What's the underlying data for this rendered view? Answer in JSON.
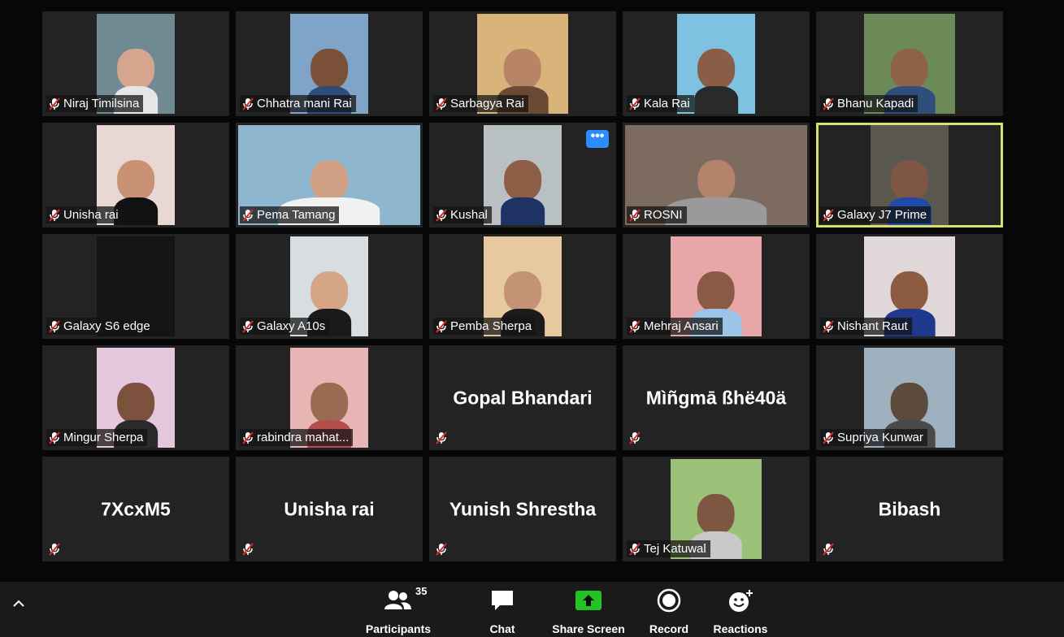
{
  "tiles": [
    {
      "label": "Niraj Timilsina",
      "video": true,
      "bg": "#6f8a93",
      "skin": "#d5a58e",
      "shirt": "#e6e6e6"
    },
    {
      "label": "Chhatra mani Rai",
      "video": true,
      "bg": "#7fa4c8",
      "skin": "#7a5138",
      "shirt": "#2e4b7a"
    },
    {
      "label": "Sarbagya Rai",
      "video": true,
      "bg": "#d8b47a",
      "skin": "#b78566",
      "shirt": "#6a4a35"
    },
    {
      "label": "Kala Rai",
      "video": true,
      "bg": "#7ec1e0",
      "skin": "#8a5d46",
      "shirt": "#2a2a2a"
    },
    {
      "label": "Bhanu Kapadi",
      "video": true,
      "bg": "#6b8a58",
      "skin": "#8e6248",
      "shirt": "#2f4f7a"
    },
    {
      "label": "Unisha rai",
      "video": true,
      "bg": "#e8d7d2",
      "skin": "#c99275",
      "shirt": "#111111"
    },
    {
      "label": "Pema Tamang",
      "video": true,
      "bg": "#8fb6cf",
      "skin": "#d1a084",
      "shirt": "#f1f1f1"
    },
    {
      "label": "Kushal",
      "video": true,
      "bg": "#b8c0c4",
      "skin": "#8d5d45",
      "shirt": "#1f3265",
      "more": "•••"
    },
    {
      "label": "ROSNI",
      "video": true,
      "bg": "#7c6b5e",
      "skin": "#b5826b",
      "shirt": "#9a9a9a"
    },
    {
      "label": "Galaxy J7 Prime",
      "video": true,
      "bg": "#5b5850",
      "skin": "#7f5643",
      "shirt": "#1e4aa8",
      "active": true
    },
    {
      "label": "Galaxy S6 edge",
      "video": true,
      "bg": "#141414",
      "skin": "#141414",
      "shirt": "#141414"
    },
    {
      "label": "Galaxy A10s",
      "video": true,
      "bg": "#d8dde2",
      "skin": "#d6a486",
      "shirt": "#1a1a1a"
    },
    {
      "label": "Pemba Sherpa",
      "video": true,
      "bg": "#e7c9a0",
      "skin": "#c49274",
      "shirt": "#1b1b1b"
    },
    {
      "label": "Mehraj Ansari",
      "video": true,
      "bg": "#e7a6a8",
      "skin": "#8a5a45",
      "shirt": "#9bc4e8"
    },
    {
      "label": "Nishant Raut",
      "video": true,
      "bg": "#dfd7d8",
      "skin": "#8d5b42",
      "shirt": "#1f3a8c"
    },
    {
      "label": "Mingur Sherpa",
      "video": true,
      "bg": "#e5c8de",
      "skin": "#7c523f",
      "shirt": "#2a2a2a"
    },
    {
      "label": "rabindra mahat...",
      "video": true,
      "bg": "#e7b5b3",
      "skin": "#9a6a52",
      "shirt": "#b44e4b"
    },
    {
      "label": "",
      "name_text": "Gopal Bhandari",
      "video": false
    },
    {
      "label": "",
      "name_text": "Mìñgmā ßhë40ä",
      "video": false
    },
    {
      "label": "Supriya Kunwar",
      "video": true,
      "bg": "#9fb0bf",
      "skin": "#5c4a3b",
      "shirt": "#4a4a4a"
    },
    {
      "label": "",
      "name_text": "7XcxM5",
      "video": false
    },
    {
      "label": "",
      "name_text": "Unisha rai",
      "video": false
    },
    {
      "label": "",
      "name_text": "Yunish Shrestha",
      "video": false
    },
    {
      "label": "Tej Katuwal",
      "video": true,
      "bg": "#9cc27a",
      "skin": "#7e5641",
      "shirt": "#c9c9c9"
    },
    {
      "label": "",
      "name_text": "Bibash",
      "video": false
    }
  ],
  "toolbar": {
    "participants_label": "Participants",
    "participants_count": "35",
    "chat_label": "Chat",
    "share_label": "Share Screen",
    "record_label": "Record",
    "reactions_label": "Reactions",
    "share_color": "#24c324"
  }
}
